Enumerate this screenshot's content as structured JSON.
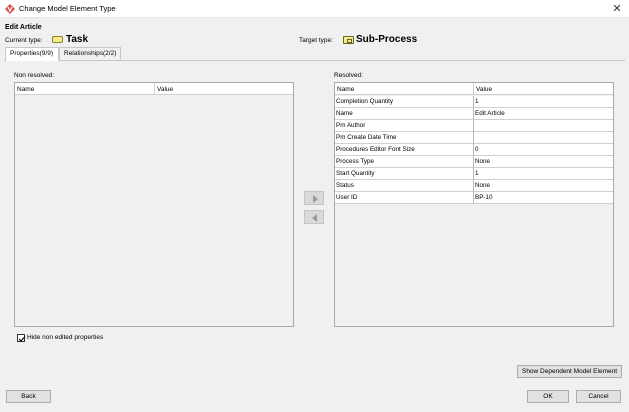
{
  "window": {
    "title": "Change Model Element Type",
    "close_glyph": "✕"
  },
  "header": {
    "element_name": "Edit Article",
    "current_type_label": "Current type:",
    "current_type_value": "Task",
    "target_type_label": "Target type:",
    "target_type_value": "Sub-Process"
  },
  "tabs": [
    {
      "label": "Properties(9/9)",
      "active": true
    },
    {
      "label": "Relationships(2/2)",
      "active": false
    }
  ],
  "non_resolved": {
    "label": "Non resolved:",
    "columns": [
      "Name",
      "Value"
    ],
    "rows": []
  },
  "resolved": {
    "label": "Resolved:",
    "columns": [
      "Name",
      "Value"
    ],
    "rows": [
      {
        "name": "Completion Quantity",
        "value": "1"
      },
      {
        "name": "Name",
        "value": "Edit Article"
      },
      {
        "name": "Pm Author",
        "value": ""
      },
      {
        "name": "Pm Create Date Time",
        "value": ""
      },
      {
        "name": "Procedures Editor Font Size",
        "value": "0"
      },
      {
        "name": "Process Type",
        "value": "None"
      },
      {
        "name": "Start Quantity",
        "value": "1"
      },
      {
        "name": "Status",
        "value": "None"
      },
      {
        "name": "User ID",
        "value": "BP-10"
      }
    ]
  },
  "options": {
    "hide_non_edited_label": "Hide non edited properties",
    "hide_non_edited_checked": true
  },
  "buttons": {
    "show_dependent": "Show Dependent Model Element",
    "back": "Back",
    "ok": "OK",
    "cancel": "Cancel"
  },
  "colors": {
    "app_icon": "#d9534f",
    "element_icon_fill": "#f7ec8c",
    "arrow_disabled": "#9a9a9a"
  },
  "icons": {
    "app": "visual-paradigm-logo-icon",
    "current_type": "task-icon",
    "target_type": "sub-process-icon",
    "move_right": "arrow-right-icon",
    "move_left": "arrow-left-icon",
    "checkbox": "checkmark-icon"
  }
}
